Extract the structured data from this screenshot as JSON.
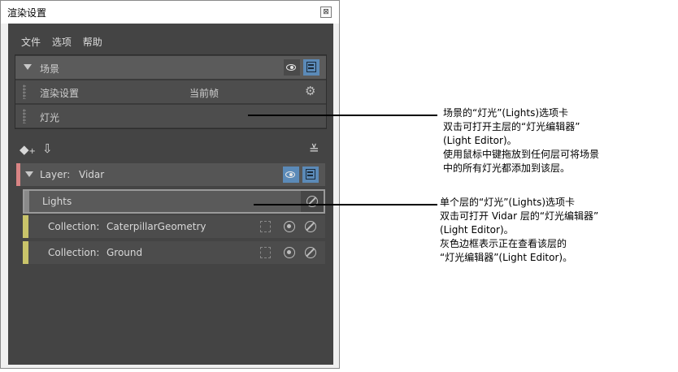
{
  "window": {
    "title": "渲染设置",
    "close_glyph": "⊠"
  },
  "menu": [
    "文件",
    "选项",
    "帮助"
  ],
  "scene": {
    "label": "场景",
    "render_settings_label": "渲染设置",
    "render_settings_value": "当前帧",
    "lights_label": "灯光"
  },
  "layer": {
    "label": "Layer:",
    "name": "Vidar",
    "lights_label": "Lights",
    "collections": [
      {
        "prefix": "Collection:",
        "name": "CaterpillarGeometry"
      },
      {
        "prefix": "Collection:",
        "name": "Ground"
      }
    ]
  },
  "toolbar_icons": [
    "create-layer-icon",
    "import-layer-icon",
    "sort-icon"
  ],
  "callouts": {
    "scene_lights": [
      "场景的“灯光”(Lights)选项卡",
      "双击可打开主层的“灯光编辑器”",
      "(Light Editor)。",
      "使用鼠标中键拖放到任何层可将场景",
      "中的所有灯光都添加到该层。"
    ],
    "layer_lights": [
      "单个层的“灯光”(Lights)选项卡",
      "双击可打开 Vidar 层的“灯光编辑器”",
      "(Light Editor)。",
      "灰色边框表示正在查看该层的",
      "“灯光编辑器”(Light Editor)。"
    ]
  },
  "colors": {
    "panel_bg": "#444444",
    "visibility_active": "#5b8ab8",
    "layer_accent": "#d98484",
    "collection_accent": "#c9c46a"
  }
}
